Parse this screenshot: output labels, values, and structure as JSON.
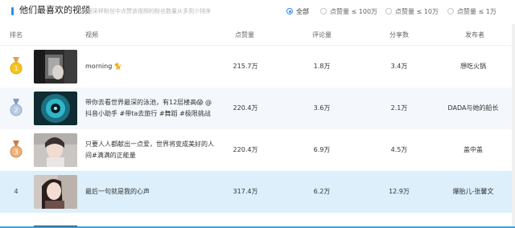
{
  "header": {
    "title": "他们最喜欢的视频",
    "desc": "根据采样粉丝中点赞该视频的粉丝数量从多到少排序"
  },
  "filters": [
    {
      "label": "全部",
      "active": true
    },
    {
      "label": "点赞量 ≤ 100万",
      "active": false
    },
    {
      "label": "点赞量 ≤ 10万",
      "active": false
    },
    {
      "label": "点赞量 ≤ 1万",
      "active": false
    }
  ],
  "columns": {
    "rank": "排名",
    "video": "视频",
    "likes": "点赞量",
    "comments": "评论量",
    "shares": "分享数",
    "author": "发布者"
  },
  "rows": [
    {
      "rank": "1",
      "medal": "gold",
      "title_line1": "morning 🐈",
      "title_line2": "",
      "likes": "215.7万",
      "comments": "1.8万",
      "shares": "3.4万",
      "author": "想吃火锅"
    },
    {
      "rank": "2",
      "medal": "silver",
      "title_line1": "带你去看世界最深的泳池，有12层楼高😱 @",
      "title_line2": "抖音小助手 #带ta去旅行 #舞蹈 #极限挑战",
      "likes": "220.4万",
      "comments": "3.6万",
      "shares": "2.1万",
      "author": "DADA与她的船长"
    },
    {
      "rank": "3",
      "medal": "bronze",
      "title_line1": "只要人人都献出一点爱，世界将变成美好的人",
      "title_line2": "间#满满的正能量",
      "likes": "220.4万",
      "comments": "6.9万",
      "shares": "4.5万",
      "author": "盖中盖"
    },
    {
      "rank": "4",
      "medal": "",
      "title_line1": "最后一句就是我的心声",
      "title_line2": "",
      "likes": "317.4万",
      "comments": "6.2万",
      "shares": "12.9万",
      "author": "爆胎儿-张馨文"
    }
  ],
  "colors": {
    "accent": "#2f8cf0",
    "gold": "#f5c518",
    "silver": "#9bb4d6",
    "bronze": "#e0a06a",
    "highlight_row": "#dceffb"
  }
}
